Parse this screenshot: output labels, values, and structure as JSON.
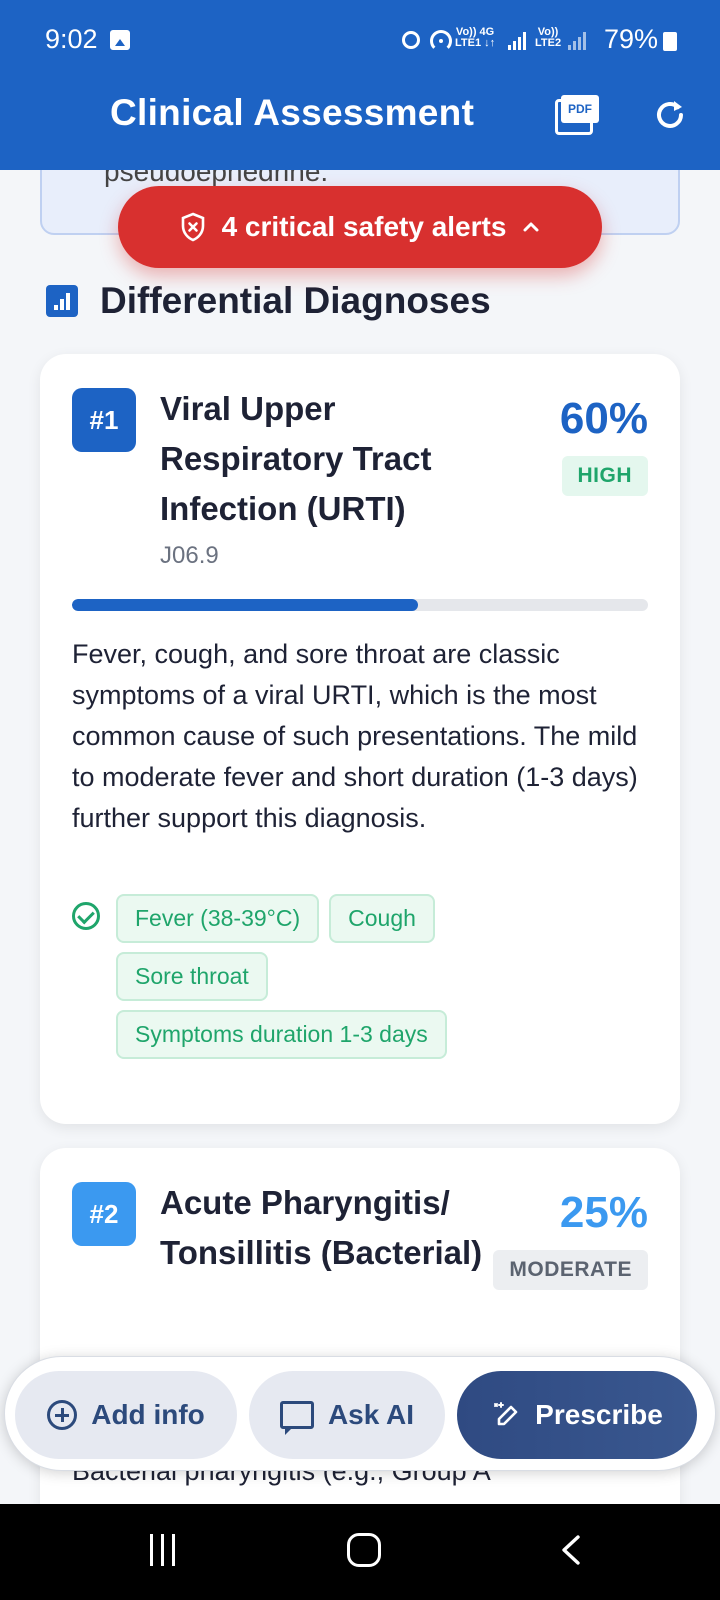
{
  "status_bar": {
    "time": "9:02",
    "sim1": "Vo)) 4G",
    "sim1_sub": "LTE1 ↓↑",
    "sim2": "Vo))",
    "sim2_sub": "LTE2",
    "battery": "79%"
  },
  "header": {
    "title": "Clinical Assessment",
    "pdf_label": "PDF",
    "accent": "#1d63c4"
  },
  "previous_card": {
    "text": "pseudoephedrine."
  },
  "alert": {
    "label": "4 critical safety alerts",
    "color": "#d8302f"
  },
  "section": {
    "title": "Differential Diagnoses"
  },
  "diagnoses": [
    {
      "rank": "#1",
      "name": "Viral Upper Respiratory Tract Infection (URTI)",
      "icd": "J06.9",
      "percent": "60%",
      "likelihood": "HIGH",
      "progress": 0.6,
      "description": "Fever, cough, and sore throat are classic symptoms of a viral URTI, which is the most common cause of such presentations. The mild to moderate fever and short duration (1-3 days) further support this diagnosis.",
      "findings": [
        "Fever (38-39°C)",
        "Cough",
        "Sore throat",
        "Symptoms duration 1-3 days"
      ]
    },
    {
      "rank": "#2",
      "name": "Acute Pharyngitis/ Tonsillitis (Bacterial)",
      "percent": "25%",
      "likelihood": "MODERATE",
      "description": "Bacterial pharyngitis (e.g., Group A"
    }
  ],
  "actions": {
    "add_info": "Add info",
    "ask_ai": "Ask AI",
    "prescribe": "Prescribe"
  }
}
